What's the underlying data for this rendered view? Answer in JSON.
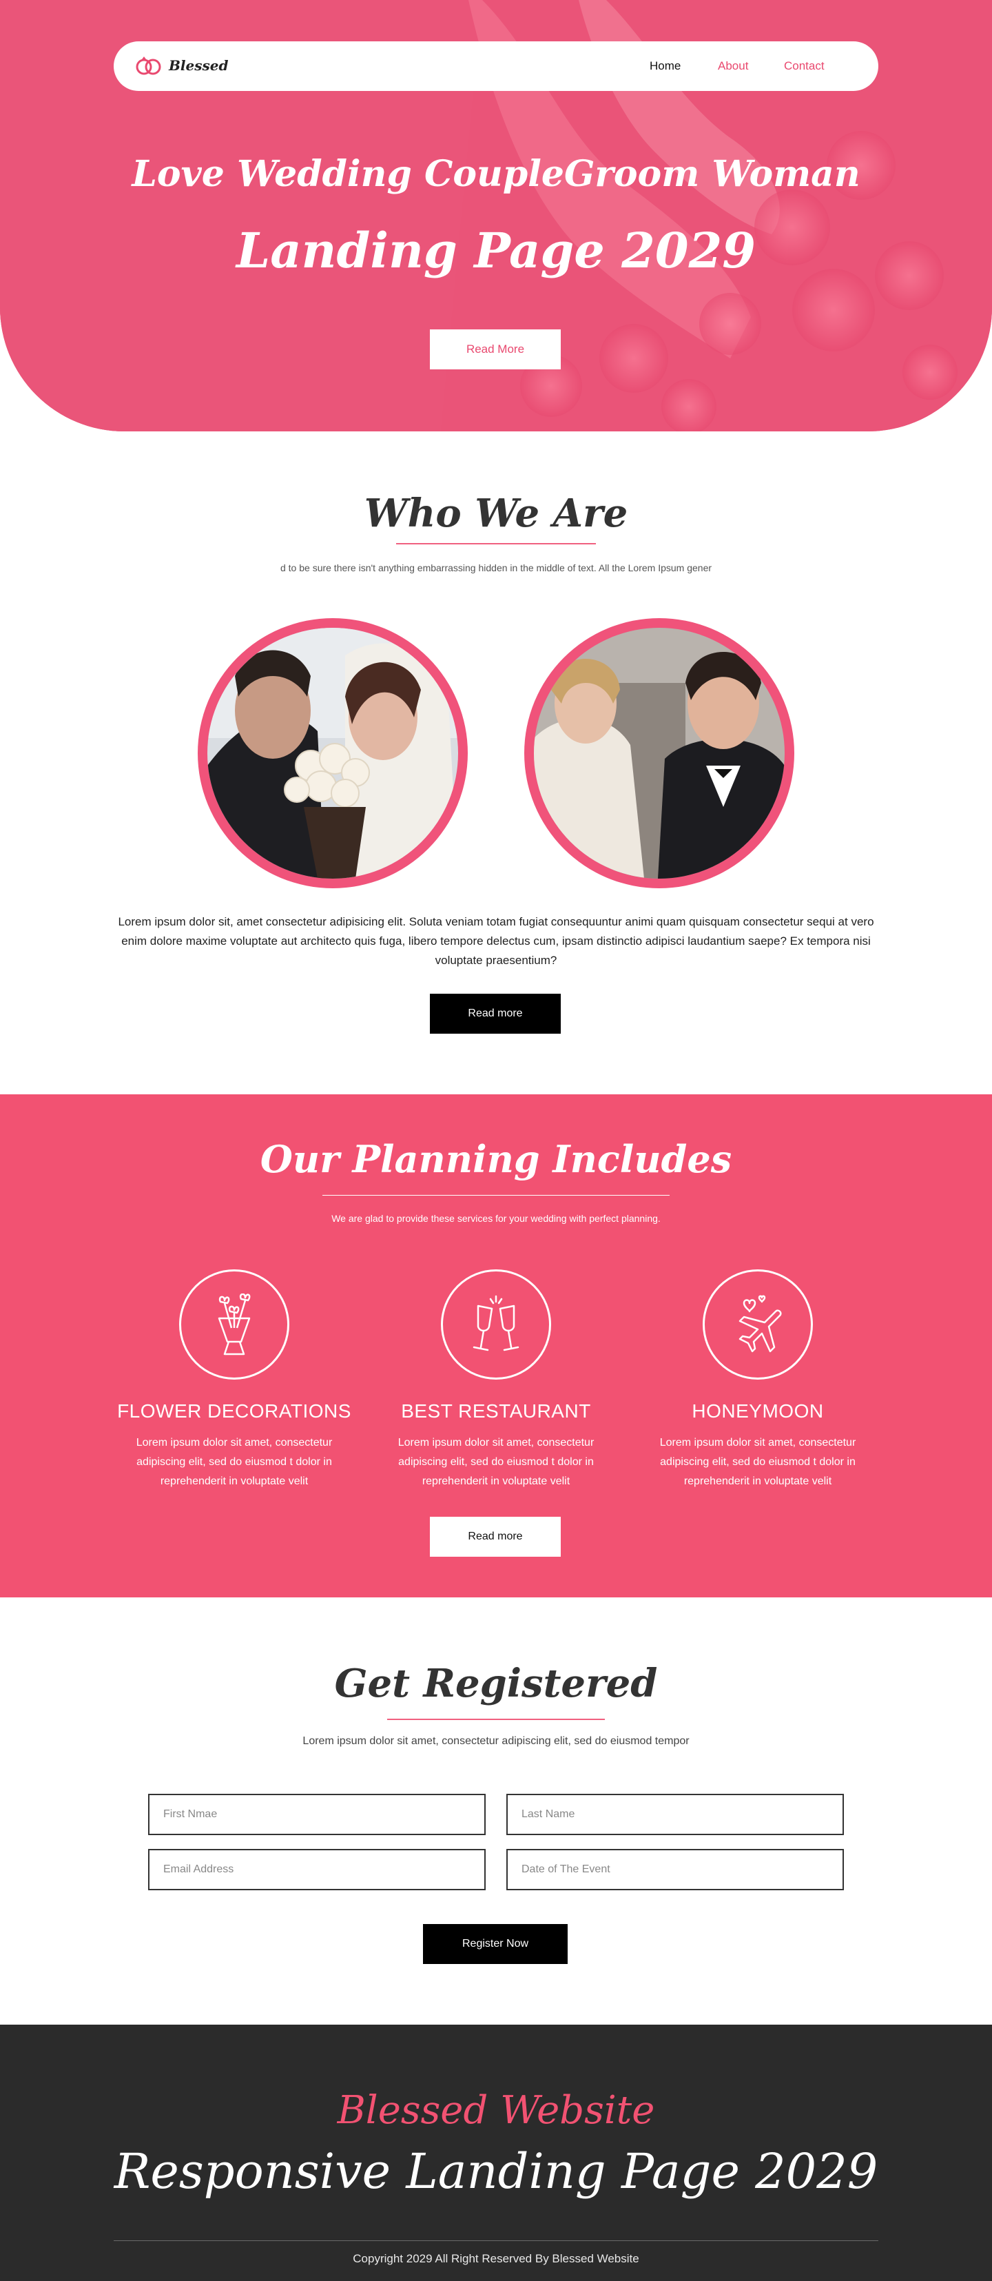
{
  "nav": {
    "brand": "Blessed",
    "links": [
      {
        "label": "Home"
      },
      {
        "label": "About"
      },
      {
        "label": "Contact"
      }
    ]
  },
  "hero": {
    "title_line1": "Love Wedding CoupleGroom Woman",
    "title_line2": "Landing Page 2029",
    "button": "Read More"
  },
  "about": {
    "title": "Who We Are",
    "subtitle": "d to be sure there isn't anything embarrassing hidden in the middle of text. All the Lorem Ipsum gener",
    "paragraph": "Lorem ipsum dolor sit, amet consectetur adipisicing elit. Soluta veniam totam fugiat consequuntur animi quam quisquam consectetur sequi at vero enim dolore maxime voluptate aut architecto quis fuga, libero tempore delectus cum, ipsam distinctio adipisci laudantium saepe? Ex tempora nisi voluptate praesentium?",
    "button": "Read more"
  },
  "planning": {
    "title": "Our Planning Includes",
    "subtitle": "We are glad to provide these services for your wedding with perfect planning.",
    "services": [
      {
        "title": "FLOWER DECORATIONS",
        "text": "Lorem ipsum dolor sit amet, consectetur adipiscing elit, sed do eiusmod t dolor in reprehenderit in voluptate velit",
        "icon": "bouquet-icon"
      },
      {
        "title": "BEST RESTAURANT",
        "text": "Lorem ipsum dolor sit amet, consectetur adipiscing elit, sed do eiusmod t dolor in reprehenderit in voluptate velit",
        "icon": "champagne-glasses-icon"
      },
      {
        "title": "HONEYMOON",
        "text": "Lorem ipsum dolor sit amet, consectetur adipiscing elit, sed do eiusmod t dolor in reprehenderit in voluptate velit",
        "icon": "airplane-hearts-icon"
      }
    ],
    "button": "Read more"
  },
  "register": {
    "title": "Get Registered",
    "subtitle": "Lorem ipsum dolor sit amet, consectetur adipiscing elit, sed do eiusmod tempor",
    "first_name_placeholder": "First Nmae",
    "last_name_placeholder": "Last Name",
    "email_placeholder": "Email Address",
    "date_placeholder": "Date of The Event",
    "button": "Register Now"
  },
  "footer": {
    "title_line1": "Blessed Website",
    "title_line2": "Responsive Landing Page 2029",
    "copyright": "Copyright 2029 All Right Reserved By Blessed Website"
  },
  "colors": {
    "accent": "#f25272",
    "dark": "#2b2b2b"
  }
}
